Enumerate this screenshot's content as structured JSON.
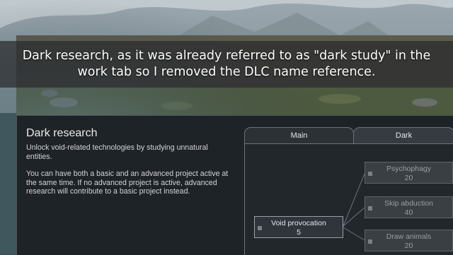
{
  "caption": {
    "text": "Dark research, as it was already referred to as \"dark study\" in the work tab so I removed the DLC name reference."
  },
  "research_panel": {
    "title": "Dark research",
    "description_1": "Unlock void-related technologies by studying unnatural entities.",
    "description_2": "You can have both a basic and an advanced project active at the same time. If no advanced project is active, advanced research will contribute to a basic project instead."
  },
  "tabs": [
    {
      "label": "Main",
      "selected": false
    },
    {
      "label": "Dark",
      "selected": true
    }
  ],
  "nodes": [
    {
      "name": "Void provocation",
      "cost": "5"
    },
    {
      "name": "Psychophagy",
      "cost": "20"
    },
    {
      "name": "Skip abduction",
      "cost": "40"
    },
    {
      "name": "Draw animals",
      "cost": "20"
    }
  ],
  "colors": {
    "window_bg": "#1e2328",
    "caption_bg": "#28292c",
    "node_locked": "#3a3f44",
    "node_available": "#2f353b"
  }
}
